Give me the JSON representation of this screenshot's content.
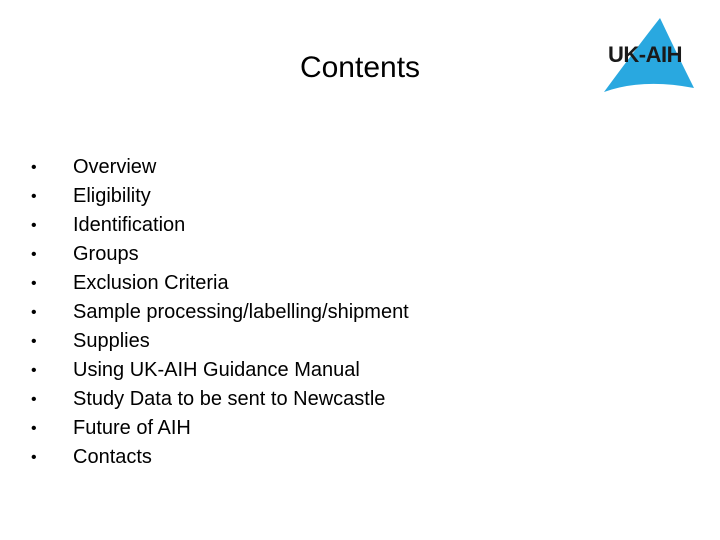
{
  "slide": {
    "title": "Contents",
    "logo": {
      "text": "UK-AIH",
      "accent_color": "#29a8e0"
    },
    "items": [
      {
        "label": "Overview"
      },
      {
        "label": "Eligibility"
      },
      {
        "label": "Identification"
      },
      {
        "label": "Groups"
      },
      {
        "label": "Exclusion Criteria"
      },
      {
        "label": "Sample processing/labelling/shipment"
      },
      {
        "label": "Supplies"
      },
      {
        "label": "Using UK-AIH Guidance Manual"
      },
      {
        "label": "Study Data to be sent to Newcastle"
      },
      {
        "label": "Future of AIH"
      },
      {
        "label": "Contacts"
      }
    ],
    "bullet_glyph": "•"
  }
}
